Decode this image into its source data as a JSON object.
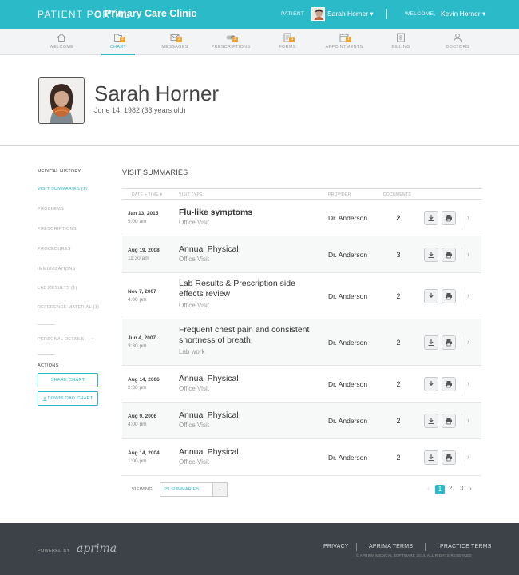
{
  "topbar": {
    "brand_part1": "PATIENT P",
    "brand_o": "O",
    "brand_part2": "RTAL",
    "clinic": "Primary Care Clinic",
    "patient_label": "PATIENT",
    "patient_name": "Sarah Horner ▾",
    "welcome_label": "WELCOME,",
    "user_name": "Kevin Horner ▾"
  },
  "nav": {
    "items": [
      {
        "label": "WELCOME",
        "icon": "home-icon",
        "badge": ""
      },
      {
        "label": "CHART",
        "icon": "chart-icon",
        "badge": "2"
      },
      {
        "label": "MESSAGES",
        "icon": "envelope-icon",
        "badge": "2"
      },
      {
        "label": "PRESCRIPTIONS",
        "icon": "pill-icon",
        "badge": "2"
      },
      {
        "label": "FORMS",
        "icon": "forms-icon",
        "badge": "3"
      },
      {
        "label": "APPOINTMENTS",
        "icon": "calendar-icon",
        "badge": "1"
      },
      {
        "label": "BILLING",
        "icon": "dollar-icon",
        "badge": ""
      },
      {
        "label": "DOCTORS",
        "icon": "doctor-icon",
        "badge": ""
      }
    ],
    "active": "CHART"
  },
  "patient": {
    "name": "Sarah Horner",
    "dob": "June 14, 1982 (33 years old)"
  },
  "sidebar": {
    "heading": "MEDICAL HISTORY",
    "items": [
      {
        "label": "VISIT SUMMARIES (1)",
        "active": true
      },
      {
        "label": "PROBLEMS",
        "active": false
      },
      {
        "label": "PRESCRIPTIONS",
        "active": false
      },
      {
        "label": "PROCEDURES",
        "active": false
      },
      {
        "label": "IMMUNIZATIONS",
        "active": false
      },
      {
        "label": "LAB RESULTS (1)",
        "active": false
      },
      {
        "label": "REFERENCE MATERIAL (1)",
        "active": false
      }
    ],
    "personal_details": "PERSONAL DETAILS",
    "personal_details_chevron": "⌄",
    "actions_heading": "ACTIONS",
    "share_chart": "SHARE CHART",
    "download_chart": "DOWNLOAD CHART"
  },
  "main": {
    "title": "VISIT SUMMARIES",
    "columns": {
      "date": "DATE + TIME ▾",
      "type": "VISIT TYPE",
      "provider": "PROVIDER",
      "documents": "DOCUMENTS"
    },
    "rows": [
      {
        "date": "Jan 13, 2015",
        "time": "9:00 am",
        "title": "Flu-like symptoms",
        "sub": "Office Visit",
        "provider": "Dr. Anderson",
        "docs": "2",
        "unread": true
      },
      {
        "date": "Aug 19, 2008",
        "time": "11:30 am",
        "title": "Annual Physical",
        "sub": "Office Visit",
        "provider": "Dr. Anderson",
        "docs": "3",
        "unread": false
      },
      {
        "date": "Nov 7, 2007",
        "time": "4:00 pm",
        "title": "Lab Results & Prescription side effects review",
        "sub": "Office Visit",
        "provider": "Dr. Anderson",
        "docs": "2",
        "unread": false
      },
      {
        "date": "Jun 4, 2007",
        "time": "3:30 pm",
        "title": "Frequent chest pain and consistent shortness of breath",
        "sub": "Lab work",
        "provider": "Dr. Anderson",
        "docs": "2",
        "unread": false
      },
      {
        "date": "Aug 14, 2006",
        "time": "2:30 pm",
        "title": "Annual Physical",
        "sub": "Office Visit",
        "provider": "Dr. Anderson",
        "docs": "2",
        "unread": false
      },
      {
        "date": "Aug 9, 2006",
        "time": "4:00 pm",
        "title": "Annual Physical",
        "sub": "Office Visit",
        "provider": "Dr. Anderson",
        "docs": "2",
        "unread": false
      },
      {
        "date": "Aug 14, 2004",
        "time": "1:00 pm",
        "title": "Annual Physical",
        "sub": "Office Visit",
        "provider": "Dr. Anderson",
        "docs": "2",
        "unread": false
      }
    ],
    "row_chevron": "›",
    "viewing_label": "VIEWING:",
    "viewing_value": "25 SUMMARIES",
    "viewing_arrow": "⌄",
    "pagination": {
      "prev": "‹",
      "pages": [
        "1",
        "2",
        "3"
      ],
      "current": "1",
      "next": "›"
    }
  },
  "footer": {
    "powered_by": "POWERED BY",
    "logo": "aprima",
    "links": [
      "PRIVACY",
      "APRIMA TERMS",
      "PRACTICE TERMS"
    ],
    "copyright": "© APRIMA MEDICAL SOFTWARE 2014. ALL RIGHTS RESERVED"
  },
  "colors": {
    "accent": "#2bbac8",
    "badge": "#f0a530",
    "footer": "#3c4247"
  }
}
